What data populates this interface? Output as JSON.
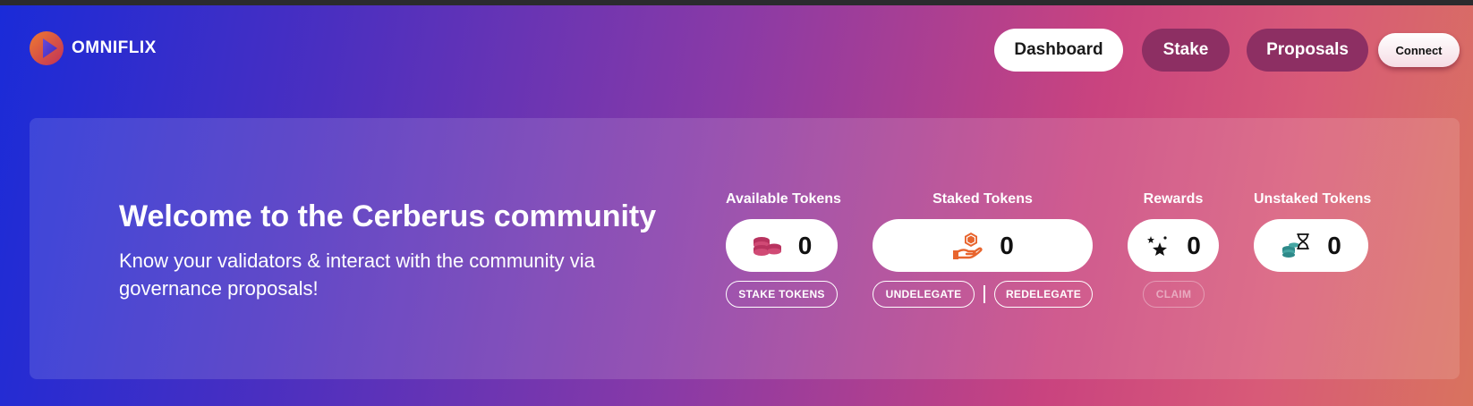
{
  "header": {
    "brand": "OMNIFLIX",
    "nav": {
      "dashboard": "Dashboard",
      "stake": "Stake",
      "proposals": "Proposals"
    },
    "connect_label": "Connect"
  },
  "welcome": {
    "title": "Welcome to the Cerberus community",
    "subtitle": "Know your validators & interact with the community via governance proposals!"
  },
  "stats": {
    "available": {
      "label": "Available Tokens",
      "value": "0",
      "icon": "coins-icon",
      "action": "STAKE TOKENS"
    },
    "staked": {
      "label": "Staked Tokens",
      "value": "0",
      "icon": "hand-token-icon",
      "actions": [
        "UNDELEGATE",
        "REDELEGATE"
      ]
    },
    "rewards": {
      "label": "Rewards",
      "value": "0",
      "icon": "stars-icon",
      "action": "CLAIM"
    },
    "unstaked": {
      "label": "Unstaked Tokens",
      "value": "0",
      "icon": "hourglass-coins-icon"
    }
  },
  "colors": {
    "nav_active_bg": "#ffffff",
    "nav_inactive_bg": "#8d2f63",
    "coin_icon": "#b8335f",
    "staked_icon": "#e8652e",
    "unstaked_icon": "#2e8a8a"
  }
}
